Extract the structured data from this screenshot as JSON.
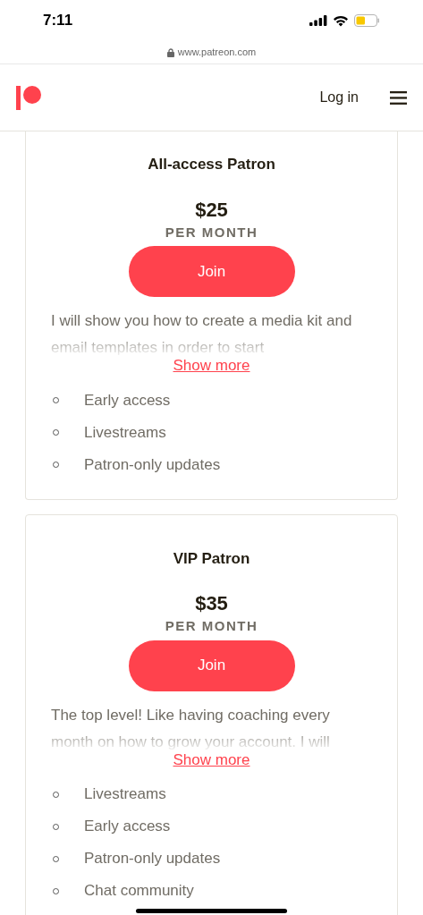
{
  "status_bar": {
    "time": "7:11"
  },
  "address_bar": {
    "url": "www.patreon.com"
  },
  "header": {
    "login": "Log in"
  },
  "tiers": [
    {
      "name": "All-access Patron",
      "price": "$25",
      "period": "PER MONTH",
      "join": "Join",
      "description": "I will show you how to create a media kit and email templates in order to start",
      "show_more": "Show more",
      "benefits": [
        "Early access",
        "Livestreams",
        "Patron-only updates"
      ]
    },
    {
      "name": "VIP Patron",
      "price": "$35",
      "period": "PER MONTH",
      "join": "Join",
      "description": "The top level! Like having coaching every month on how to grow your account. I will",
      "show_more": "Show more",
      "benefits": [
        "Livestreams",
        "Early access",
        "Patron-only updates",
        "Chat community"
      ]
    }
  ]
}
